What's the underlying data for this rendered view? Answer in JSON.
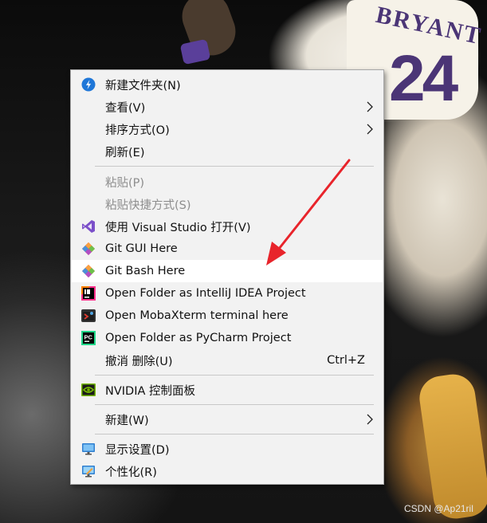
{
  "menu": {
    "items": [
      {
        "label": "新建文件夹(N)",
        "icon": "new-folder-blue-icon"
      },
      {
        "label": "查看(V)",
        "submenu": true
      },
      {
        "label": "排序方式(O)",
        "submenu": true
      },
      {
        "label": "刷新(E)"
      },
      {
        "label": "粘贴(P)",
        "disabled": true
      },
      {
        "label": "粘贴快捷方式(S)",
        "disabled": true
      },
      {
        "label": "使用 Visual Studio 打开(V)",
        "icon": "visual-studio-icon"
      },
      {
        "label": "Git GUI Here",
        "icon": "git-icon"
      },
      {
        "label": "Git Bash Here",
        "icon": "git-icon",
        "highlighted": true
      },
      {
        "label": "Open Folder as IntelliJ IDEA Project",
        "icon": "intellij-idea-icon"
      },
      {
        "label": "Open MobaXterm terminal here",
        "icon": "mobaxterm-icon"
      },
      {
        "label": "Open Folder as PyCharm Project",
        "icon": "pycharm-icon"
      },
      {
        "label": "撤消 删除(U)",
        "shortcut": "Ctrl+Z"
      },
      {
        "label": "NVIDIA 控制面板",
        "icon": "nvidia-icon"
      },
      {
        "label": "新建(W)",
        "submenu": true
      },
      {
        "label": "显示设置(D)",
        "icon": "display-settings-icon"
      },
      {
        "label": "个性化(R)",
        "icon": "personalize-icon"
      }
    ]
  },
  "background": {
    "jersey_name": "BRYANT",
    "jersey_number": "24"
  },
  "watermark": "CSDN @Ap21ril",
  "colors": {
    "menu_bg": "#f2f2f2",
    "highlight": "#ffffff",
    "disabled_text": "#8d8d8d",
    "annotation_arrow": "#e8242b"
  }
}
